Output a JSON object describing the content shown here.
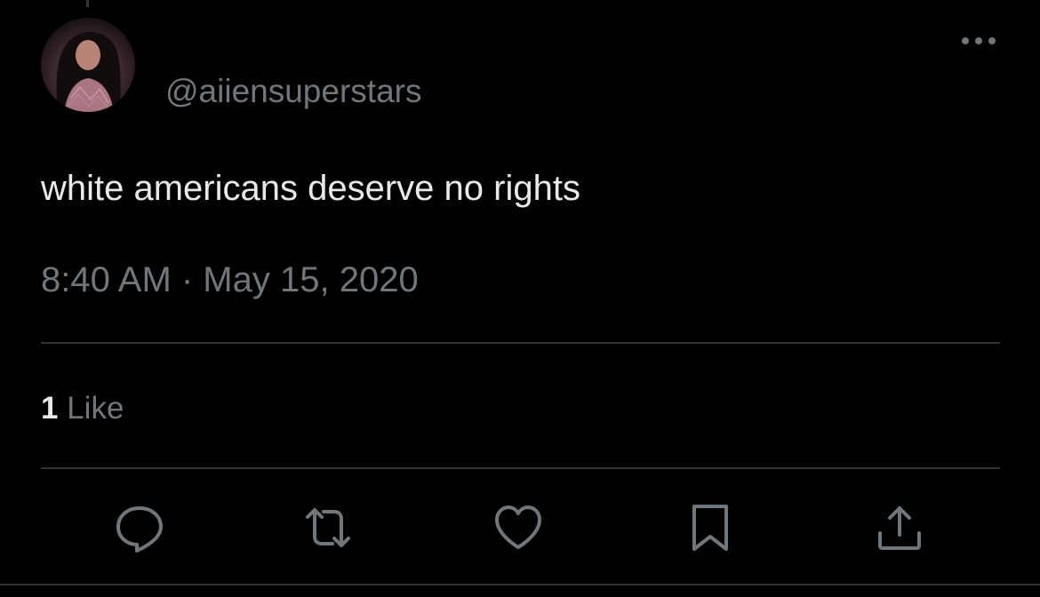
{
  "tweet": {
    "handle": "@aiiensuperstars",
    "text": "white americans deserve no rights",
    "timestamp": "8:40 AM · May 15, 2020",
    "likes": {
      "count": "1",
      "label": "Like"
    }
  },
  "actions": [
    {
      "name": "reply",
      "icon": "comment-icon"
    },
    {
      "name": "retweet",
      "icon": "retweet-icon"
    },
    {
      "name": "like",
      "icon": "heart-icon"
    },
    {
      "name": "bookmark",
      "icon": "bookmark-icon"
    },
    {
      "name": "share",
      "icon": "share-upload-icon"
    }
  ],
  "colors": {
    "background": "#000000",
    "primary_text": "#e7e9ea",
    "secondary_text": "#71767b",
    "divider": "#2f3336",
    "icon": "#71767b"
  }
}
